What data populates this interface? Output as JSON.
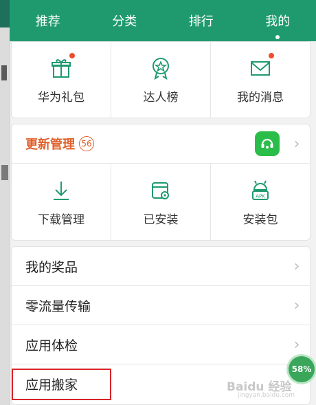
{
  "tabs": [
    "推荐",
    "分类",
    "排行",
    "我的"
  ],
  "active_tab_index": 3,
  "row1": [
    {
      "label": "华为礼包",
      "icon": "gift-icon",
      "has_dot": true
    },
    {
      "label": "达人榜",
      "icon": "medal-icon",
      "has_dot": false
    },
    {
      "label": "我的消息",
      "icon": "mail-icon",
      "has_dot": true
    }
  ],
  "update": {
    "title": "更新管理",
    "count": "56",
    "icon": "customer-service-icon"
  },
  "row2": [
    {
      "label": "下载管理",
      "icon": "download-icon"
    },
    {
      "label": "已安装",
      "icon": "installed-icon"
    },
    {
      "label": "安装包",
      "icon": "apk-package-icon"
    }
  ],
  "list": [
    {
      "label": "我的奖品"
    },
    {
      "label": "零流量传输"
    },
    {
      "label": "应用体检"
    },
    {
      "label": "应用搬家"
    }
  ],
  "floating_percent": "58%",
  "watermark": "Baidu 经验",
  "watermark_url": "jingyan.baidu.com",
  "colors": {
    "accent": "#1f9a6f",
    "update": "#e0602a",
    "highlight": "#d9242a",
    "dot": "#ee4d2d"
  }
}
